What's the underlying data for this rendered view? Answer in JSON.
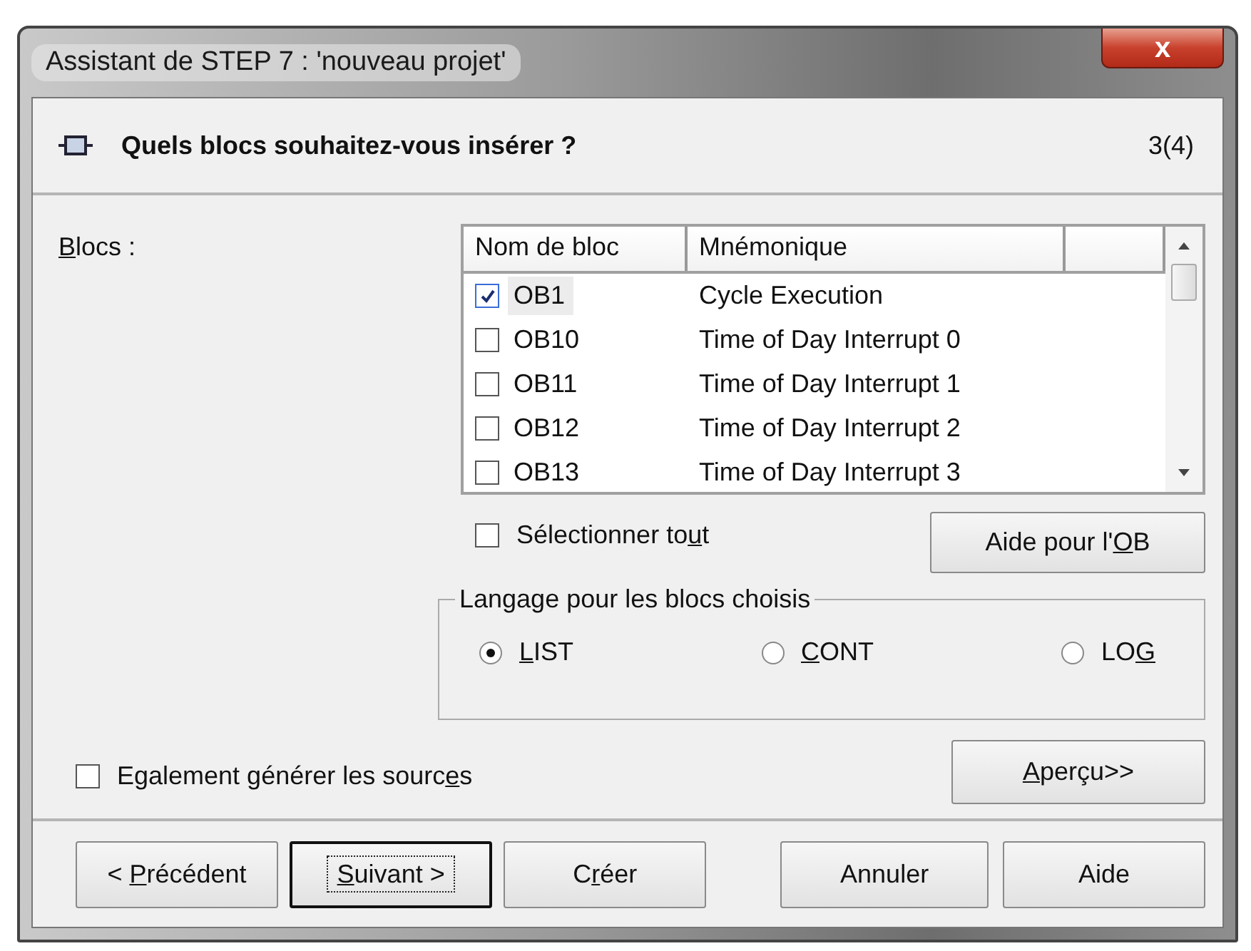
{
  "window": {
    "title": "Assistant de STEP 7 : 'nouveau projet'",
    "close": "x"
  },
  "header": {
    "title": "Quels blocs souhaitez-vous insérer ?",
    "step": "3(4)"
  },
  "blocks_label": {
    "key": "B",
    "after": "locs :"
  },
  "table": {
    "columns": [
      "Nom de bloc",
      "Mnémonique"
    ],
    "rows": [
      {
        "name": "OB1",
        "mnemonic": "Cycle Execution",
        "checked": true,
        "selected": true
      },
      {
        "name": "OB10",
        "mnemonic": "Time of Day Interrupt 0",
        "checked": false,
        "selected": false
      },
      {
        "name": "OB11",
        "mnemonic": "Time of Day Interrupt 1",
        "checked": false,
        "selected": false
      },
      {
        "name": "OB12",
        "mnemonic": "Time of Day Interrupt 2",
        "checked": false,
        "selected": false
      },
      {
        "name": "OB13",
        "mnemonic": "Time of Day Interrupt 3",
        "checked": false,
        "selected": false
      }
    ]
  },
  "select_all": {
    "before": "Sélectionner to",
    "key": "u",
    "after": "t",
    "checked": false
  },
  "ob_help_button": {
    "before": "Aide pour l'",
    "key": "O",
    "after": "B"
  },
  "language_group": {
    "title": "Langage pour les blocs choisis",
    "options": [
      {
        "key": "L",
        "after": "IST",
        "selected": true
      },
      {
        "key": "C",
        "after": "ONT",
        "selected": false
      },
      {
        "before": "LO",
        "key": "G",
        "selected": false
      }
    ]
  },
  "generate_sources": {
    "before": "Egalement générer les sourc",
    "key": "e",
    "after": "s",
    "checked": false
  },
  "preview_button": {
    "key": "A",
    "after": "perçu>>"
  },
  "buttons": [
    {
      "before": "< ",
      "key": "P",
      "after": "récédent",
      "focused": false
    },
    {
      "key": "S",
      "after": "uivant >",
      "focused": true
    },
    {
      "before": "C",
      "key": "r",
      "after": "éer",
      "focused": false
    },
    {
      "before": "Annuler",
      "focused": false
    },
    {
      "before": "Aide",
      "focused": false
    }
  ]
}
